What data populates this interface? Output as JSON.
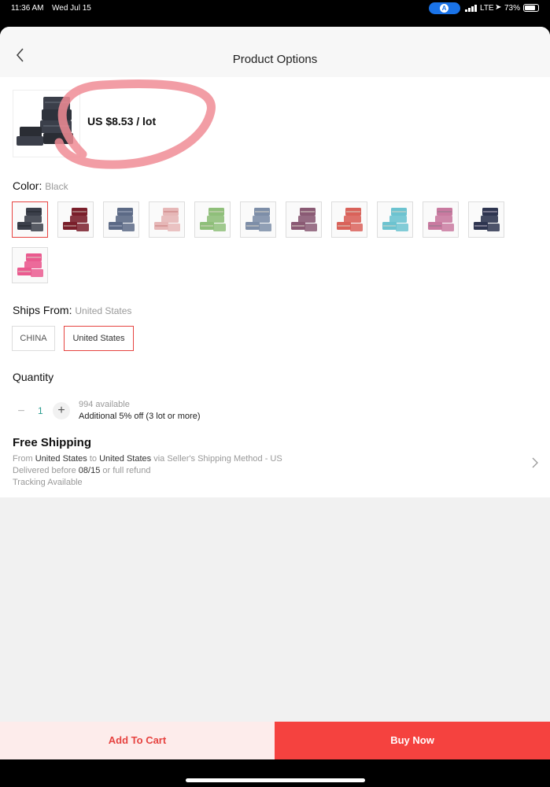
{
  "status_bar": {
    "time": "11:36 AM",
    "date": "Wed Jul 15",
    "network": "LTE",
    "battery": "73%"
  },
  "header": {
    "title": "Product Options"
  },
  "product": {
    "price": "US $8.53 / lot"
  },
  "color": {
    "label": "Color:",
    "selected": "Black",
    "swatches": [
      {
        "bg": "#3b3f4a",
        "accent": "#22252c"
      },
      {
        "bg": "#7a1f2b",
        "accent": "#c9b9b0"
      },
      {
        "bg": "#5c6a86",
        "accent": "#aab3c5"
      },
      {
        "bg": "#e6b7b7",
        "accent": "#c77a7a"
      },
      {
        "bg": "#8fbf7a",
        "accent": "#d9d4c7"
      },
      {
        "bg": "#7d8ea8",
        "accent": "#d9d4c7"
      },
      {
        "bg": "#8a5a74",
        "accent": "#d9d4c7"
      },
      {
        "bg": "#d9625a",
        "accent": "#d9d4c7"
      },
      {
        "bg": "#6cc3d0",
        "accent": "#d9d4c7"
      },
      {
        "bg": "#c97aa0",
        "accent": "#8a7a8a"
      },
      {
        "bg": "#2e3550",
        "accent": "#c0b6c8"
      },
      {
        "bg": "#ea5a8f",
        "accent": "#d9d4c7"
      }
    ]
  },
  "ships_from": {
    "label": "Ships From:",
    "selected": "United States",
    "options": [
      "CHINA",
      "United States"
    ]
  },
  "quantity": {
    "label": "Quantity",
    "value": "1",
    "available": "994 available",
    "discount": "Additional 5% off (3 lot or more)"
  },
  "shipping": {
    "title": "Free Shipping",
    "from_prefix": "From",
    "from": "United States",
    "to_prefix": "to",
    "to": "United States",
    "method": "via Seller's Shipping Method - US",
    "delivered_prefix": "Delivered before",
    "delivered_date": "08/15",
    "delivered_suffix": "or full refund",
    "tracking": "Tracking Available"
  },
  "actions": {
    "add_to_cart": "Add To Cart",
    "buy_now": "Buy Now"
  }
}
